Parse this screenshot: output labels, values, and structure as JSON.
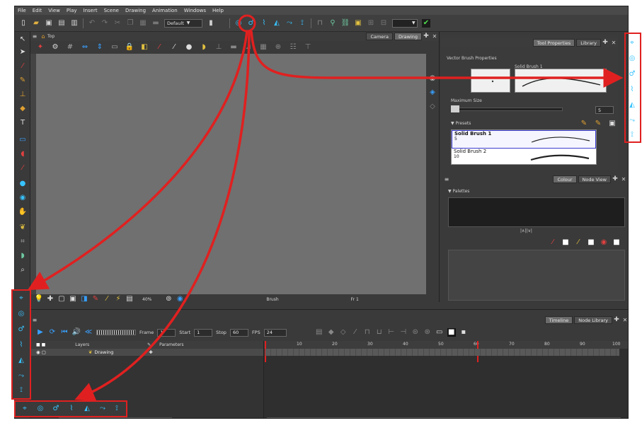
{
  "menu": [
    "File",
    "Edit",
    "View",
    "Play",
    "Insert",
    "Scene",
    "Drawing",
    "Animation",
    "Windows",
    "Help"
  ],
  "toolbar": {
    "workspace": "Default"
  },
  "camera_panel": {
    "breadcrumb": "Top",
    "tabs": [
      "Camera",
      "Drawing"
    ],
    "zoom": "40%",
    "tool_name": "Brush",
    "frame": "Fr 1"
  },
  "tool_properties": {
    "tabs": [
      "Tool Properties",
      "Library"
    ],
    "section_title": "Vector Brush Properties",
    "preview_label": "Solid Brush 1",
    "max_size_label": "Maximum Size",
    "max_size_value": "5",
    "presets_label": "Presets",
    "presets": [
      {
        "name": "Solid Brush 1",
        "size": "5"
      },
      {
        "name": "Solid Brush 2",
        "size": "10"
      }
    ]
  },
  "colour_panel": {
    "tabs": [
      "Colour",
      "Node View"
    ],
    "palettes_label": "Palettes"
  },
  "timeline": {
    "tabs": [
      "Timeline",
      "Node Library"
    ],
    "frame_label": "Frame",
    "frame_value": "1",
    "start_label": "Start",
    "start_value": "1",
    "stop_label": "Stop",
    "stop_value": "60",
    "fps_label": "FPS",
    "fps_value": "24",
    "layers_header": "Layers",
    "parameters_header": "Parameters",
    "layer_name": "Drawing",
    "ruler_ticks": [
      "10",
      "20",
      "30",
      "40",
      "50",
      "60",
      "70",
      "80",
      "90",
      "100"
    ]
  },
  "deformation_toolbar_icons": [
    "show-control-icon",
    "rigging-tool-icon",
    "transform-tool-icon",
    "curve-tool-icon",
    "envelope-tool-icon",
    "weighted-deform-icon",
    "deform-tool-icon"
  ],
  "highlight_color": "#e02020",
  "icon_color": "#38c3ff"
}
